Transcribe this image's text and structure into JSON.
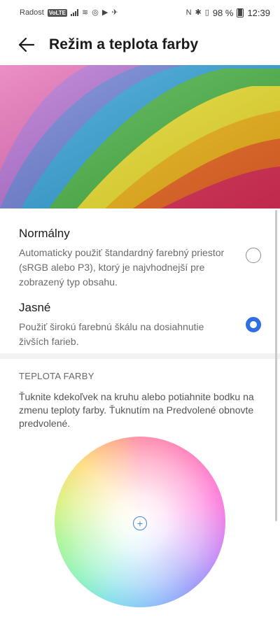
{
  "status_bar": {
    "carrier": "Radost",
    "network_badge": "VoLTE",
    "battery": "98 %",
    "time": "12:39",
    "icons": [
      "signal-icon",
      "wifi-icon",
      "data-icon",
      "youtube-icon",
      "notification-icon",
      "nfc-icon",
      "bluetooth-icon",
      "vibrate-icon",
      "battery-icon"
    ]
  },
  "app_bar": {
    "title": "Režim a teplota farby",
    "back_icon": "arrow-left-icon"
  },
  "hero": {
    "colors": [
      "#e2315a",
      "#f26a24",
      "#f7b918",
      "#f3e62f",
      "#4db947",
      "#31a4dc",
      "#6c7fd7",
      "#b46dd3",
      "#e66ab5"
    ]
  },
  "color_modes": {
    "normal": {
      "title": "Normálny",
      "description": "Automaticky použiť štandardný farebný priestor (sRGB alebo P3), ktorý je najvhodnejší pre zobrazený typ obsahu.",
      "selected": false
    },
    "vivid": {
      "title": "Jasné",
      "description": "Použiť širokú farebnú škálu na dosiahnutie živších farieb.",
      "selected": true
    }
  },
  "color_temperature": {
    "section_title": "TEPLOTA FARBY",
    "description": "Ťuknite kdekoľvek na kruhu alebo potiahnite bodku na zmenu teploty farby. Ťuknutím na Predvolené obnovte predvolené.",
    "handle_symbol": "+"
  },
  "accent_color": "#2f6fe4"
}
